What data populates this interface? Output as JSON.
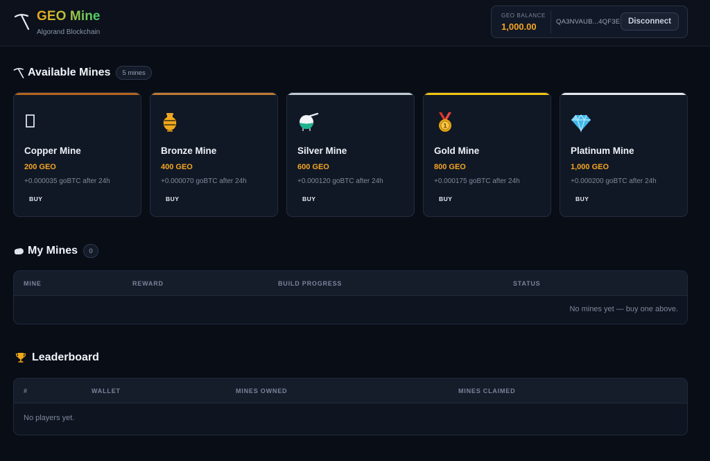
{
  "header": {
    "brand_title": "GEO Mine",
    "brand_subtitle": "Algorand Blockchain",
    "logo_icon": "pickaxe-icon",
    "wallet": {
      "balance_label": "GEO BALANCE",
      "balance_value": "1,000.00",
      "address": "QA3NVAUB...4QF3E",
      "disconnect_label": "Disconnect"
    }
  },
  "available_mines": {
    "title": "Available Mines",
    "icon": "pickaxe-icon",
    "count_label": "5 mines",
    "cards": [
      {
        "name": "Copper Mine",
        "price": "200 GEO",
        "reward": "+0.000035 goBTC after 24h",
        "buy_label": "BUY",
        "icon": "missing-glyph-icon",
        "accent": "#b5651d"
      },
      {
        "name": "Bronze Mine",
        "price": "400 GEO",
        "reward": "+0.000070 goBTC after 24h",
        "buy_label": "BUY",
        "icon": "amphora-icon",
        "accent": "#c07a32"
      },
      {
        "name": "Silver Mine",
        "price": "600 GEO",
        "reward": "+0.000120 goBTC after 24h",
        "buy_label": "BUY",
        "icon": "flask-icon",
        "accent": "#c4c8cf"
      },
      {
        "name": "Gold Mine",
        "price": "800 GEO",
        "reward": "+0.000175 goBTC after 24h",
        "buy_label": "BUY",
        "icon": "medal-icon",
        "accent": "#f2c40f"
      },
      {
        "name": "Platinum Mine",
        "price": "1,000 GEO",
        "reward": "+0.000200 goBTC after 24h",
        "buy_label": "BUY",
        "icon": "gem-icon",
        "accent": "#e6e8ec"
      }
    ]
  },
  "my_mines": {
    "title": "My Mines",
    "icon": "rock-icon",
    "count_label": "0",
    "columns": [
      "MINE",
      "REWARD",
      "BUILD PROGRESS",
      "STATUS"
    ],
    "empty_message": "No mines yet — buy one above."
  },
  "leaderboard": {
    "title": "Leaderboard",
    "icon": "trophy-icon",
    "columns": [
      "#",
      "WALLET",
      "MINES OWNED",
      "MINES CLAIMED"
    ],
    "empty_message": "No players yet."
  },
  "colors": {
    "background": "#090d16",
    "accent_orange": "#f5a623",
    "brand_green": "#3fcf6e"
  }
}
